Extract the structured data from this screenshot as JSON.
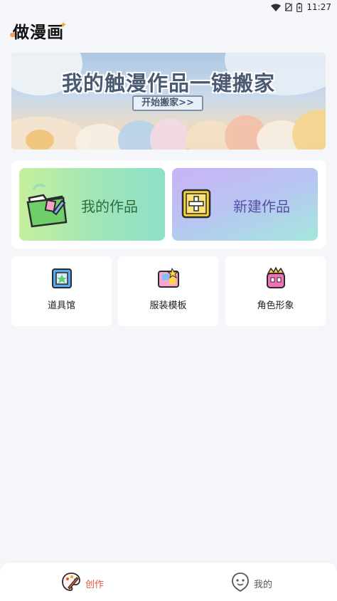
{
  "status_bar": {
    "time": "11:27",
    "icons": [
      "wifi-icon",
      "no-sim-icon",
      "battery-icon"
    ]
  },
  "app": {
    "title": "做漫画"
  },
  "banner": {
    "headline": "我的触漫作品一键搬家",
    "cta_label": "开始搬家>>"
  },
  "actions": {
    "my_works": {
      "label": "我的作品",
      "icon": "folder-icon"
    },
    "new_work": {
      "label": "新建作品",
      "icon": "plus-icon"
    }
  },
  "tools": [
    {
      "label": "道具馆",
      "icon": "prop-frame-icon"
    },
    {
      "label": "服装模板",
      "icon": "clothing-icon"
    },
    {
      "label": "角色形象",
      "icon": "character-icon"
    }
  ],
  "bottom_nav": {
    "create_label": "创作",
    "mine_label": "我的"
  },
  "colors": {
    "active_nav": "#e0583a",
    "inactive_nav": "#555555",
    "page_bg": "#f5f6fa"
  }
}
